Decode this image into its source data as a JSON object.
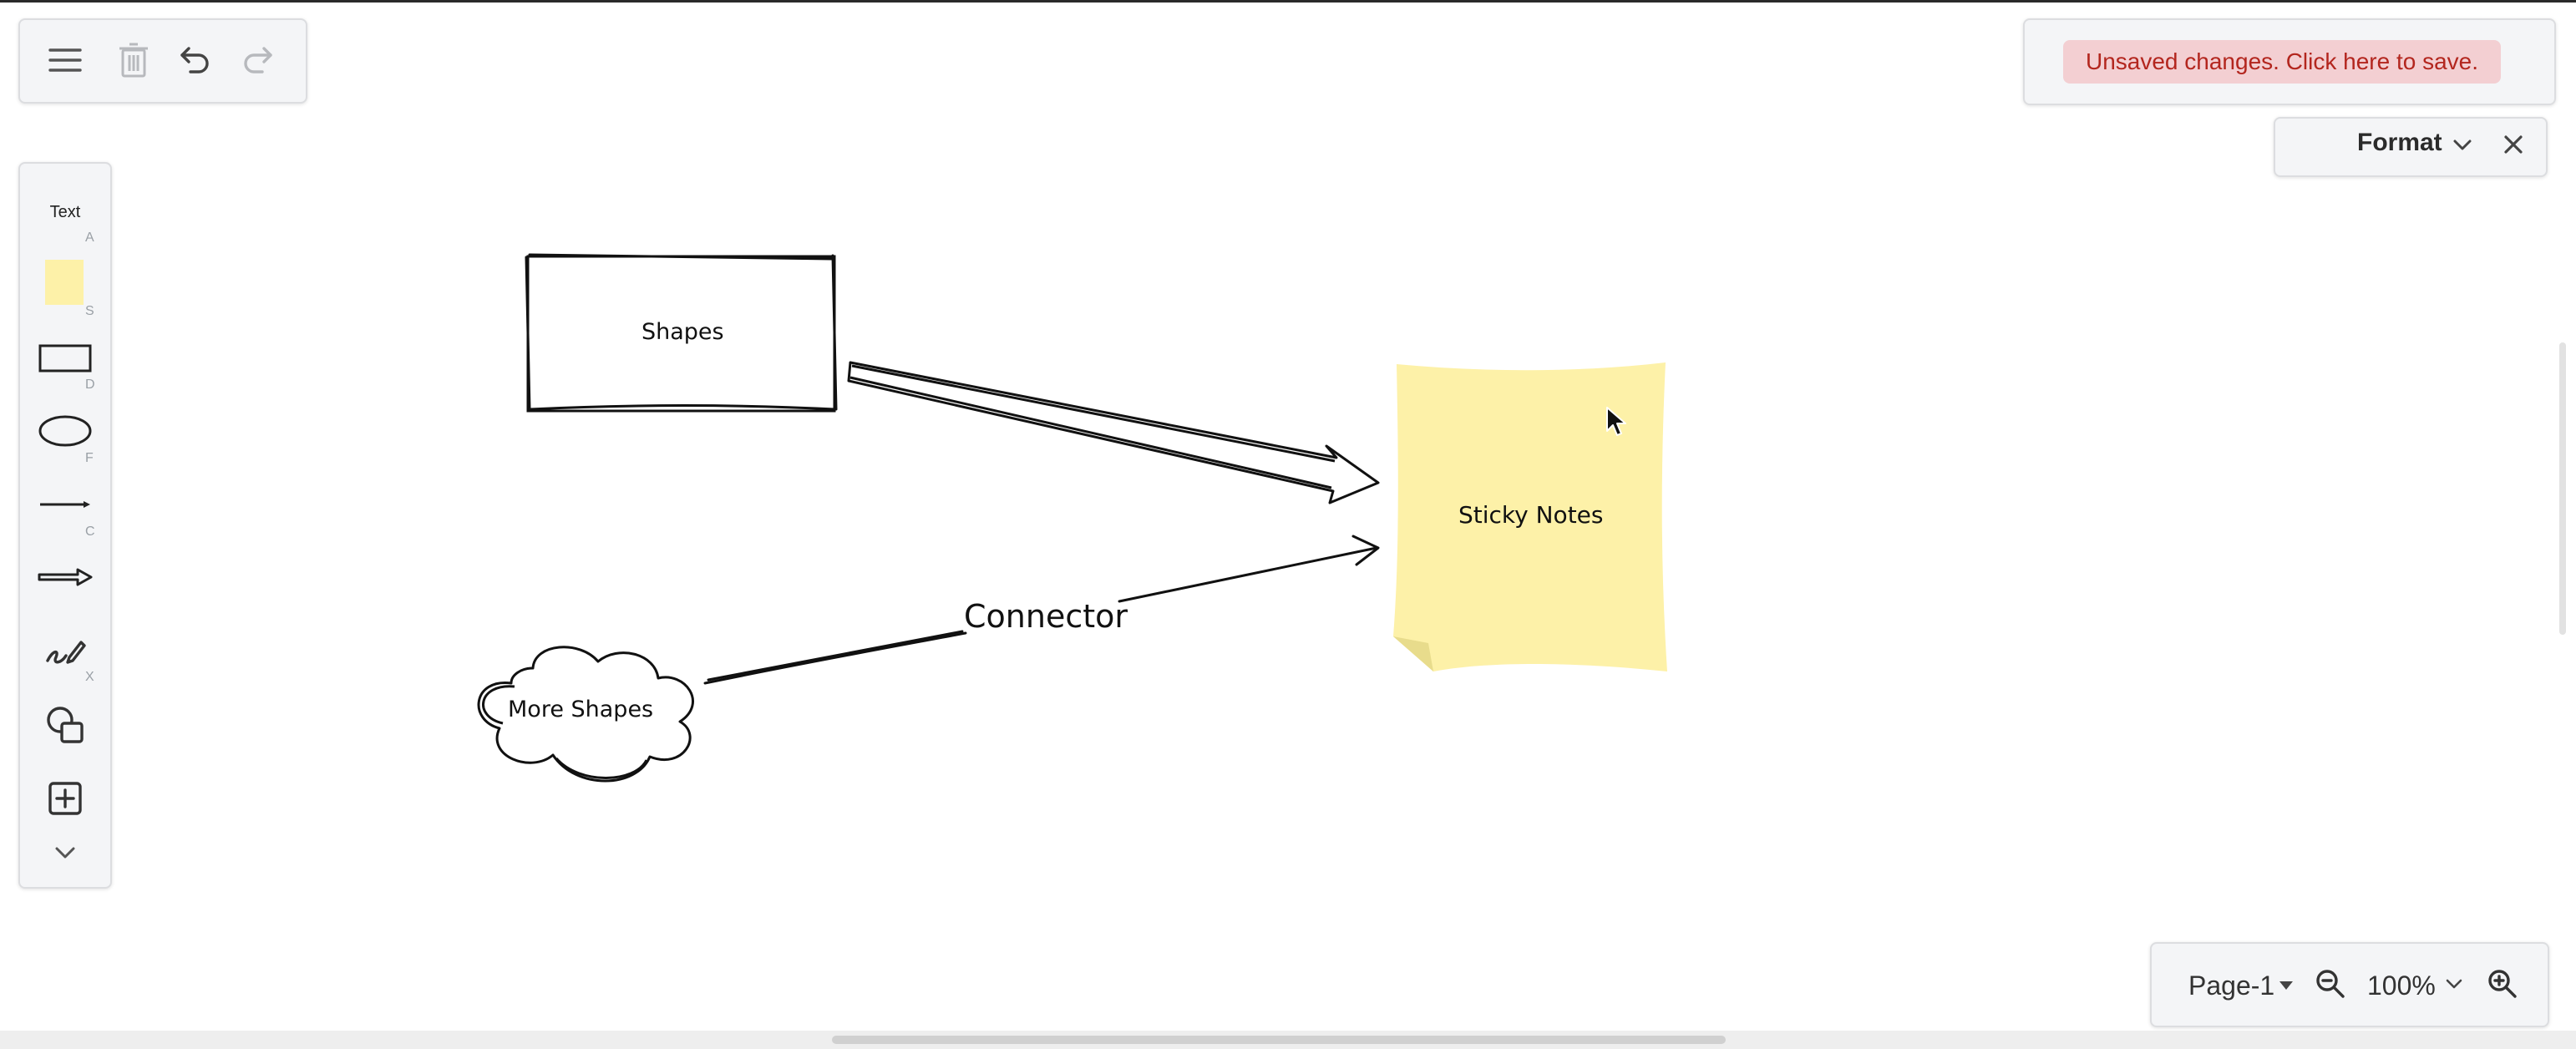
{
  "toolbar": {
    "menu_icon": "menu-icon",
    "delete_icon": "trash-icon",
    "undo_icon": "undo-icon",
    "redo_icon": "redo-icon"
  },
  "save_banner": {
    "text": "Unsaved changes. Click here to save.",
    "bg_color": "#f3cfd2",
    "text_color": "#b3261e"
  },
  "format_panel": {
    "label": "Format",
    "chevron_icon": "chevron-down-icon",
    "close_icon": "close-icon"
  },
  "left_tools": {
    "items": [
      {
        "label": "Text",
        "shortcut": "A",
        "icon": "text-tool"
      },
      {
        "label": "",
        "shortcut": "S",
        "icon": "sticky-note-icon"
      },
      {
        "label": "",
        "shortcut": "D",
        "icon": "rectangle-icon"
      },
      {
        "label": "",
        "shortcut": "F",
        "icon": "ellipse-icon"
      },
      {
        "label": "",
        "shortcut": "C",
        "icon": "line-icon"
      },
      {
        "label": "",
        "shortcut": "",
        "icon": "arrow-icon"
      },
      {
        "label": "",
        "shortcut": "X",
        "icon": "freehand-icon"
      },
      {
        "label": "",
        "shortcut": "",
        "icon": "shapes-icon"
      },
      {
        "label": "",
        "shortcut": "",
        "icon": "insert-icon"
      },
      {
        "label": "",
        "shortcut": "",
        "icon": "chevron-down-icon"
      }
    ]
  },
  "canvas": {
    "shapes_label": "Shapes",
    "sticky_label": "Sticky Notes",
    "cloud_label": "More Shapes",
    "connector_label": "Connector",
    "sticky_color": "#fdf1a8"
  },
  "bottom_bar": {
    "page_label": "Page-1",
    "zoom_value": "100%",
    "zoom_out_icon": "zoom-out-icon",
    "zoom_in_icon": "zoom-in-icon"
  }
}
